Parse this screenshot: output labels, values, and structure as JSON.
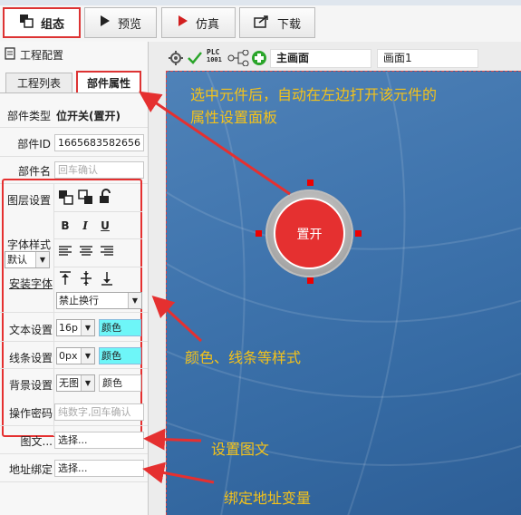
{
  "toolbar": {
    "tabs": [
      {
        "label": "组态"
      },
      {
        "label": "预览"
      },
      {
        "label": "仿真"
      },
      {
        "label": "下载"
      }
    ]
  },
  "left_panel": {
    "title": "工程配置",
    "tabs": [
      "工程列表",
      "部件属性"
    ],
    "props": {
      "type_label": "部件类型",
      "type_value": "位开关(置开)",
      "id_label": "部件ID",
      "id_value": "1665683582656",
      "name_label": "部件名",
      "name_placeholder": "回车确认",
      "layer_label": "图层设置",
      "font_style_label": "字体样式",
      "font_default": "默认",
      "install_font_label": "安装字体",
      "wrap_option": "禁止换行",
      "text_label": "文本设置",
      "text_size": "16p",
      "color_label": "颜色",
      "line_label": "线条设置",
      "line_size": "0px",
      "bg_label": "背景设置",
      "bg_value": "无图",
      "password_label": "操作密码",
      "password_placeholder": "纯数字,回车确认",
      "graphic_label": "图文...",
      "graphic_value": "选择...",
      "address_label": "地址绑定",
      "address_value": "选择..."
    }
  },
  "canvas_toolbar": {
    "plc_label": "PLC",
    "tabs": [
      "主画面",
      "画面1"
    ]
  },
  "canvas": {
    "button_label": "置开"
  },
  "annotations": {
    "top_line1": "选中元件后，自动在左边打开该元件的",
    "top_line2": "属性设置面板",
    "style": "颜色、线条等样式",
    "graphic": "设置图文",
    "address": "绑定地址变量"
  },
  "colors": {
    "accent_red": "#e53030",
    "annotation_yellow": "#f4c21a",
    "canvas_blue": "#3f74ad",
    "swatch_cyan": "#6ef6f8",
    "add_green": "#2aa52a"
  },
  "icons": [
    "gear-icon",
    "check-icon",
    "plc-icon",
    "tree-icon",
    "add-icon",
    "play-icon",
    "export-icon",
    "config-icon",
    "layers-icon"
  ]
}
